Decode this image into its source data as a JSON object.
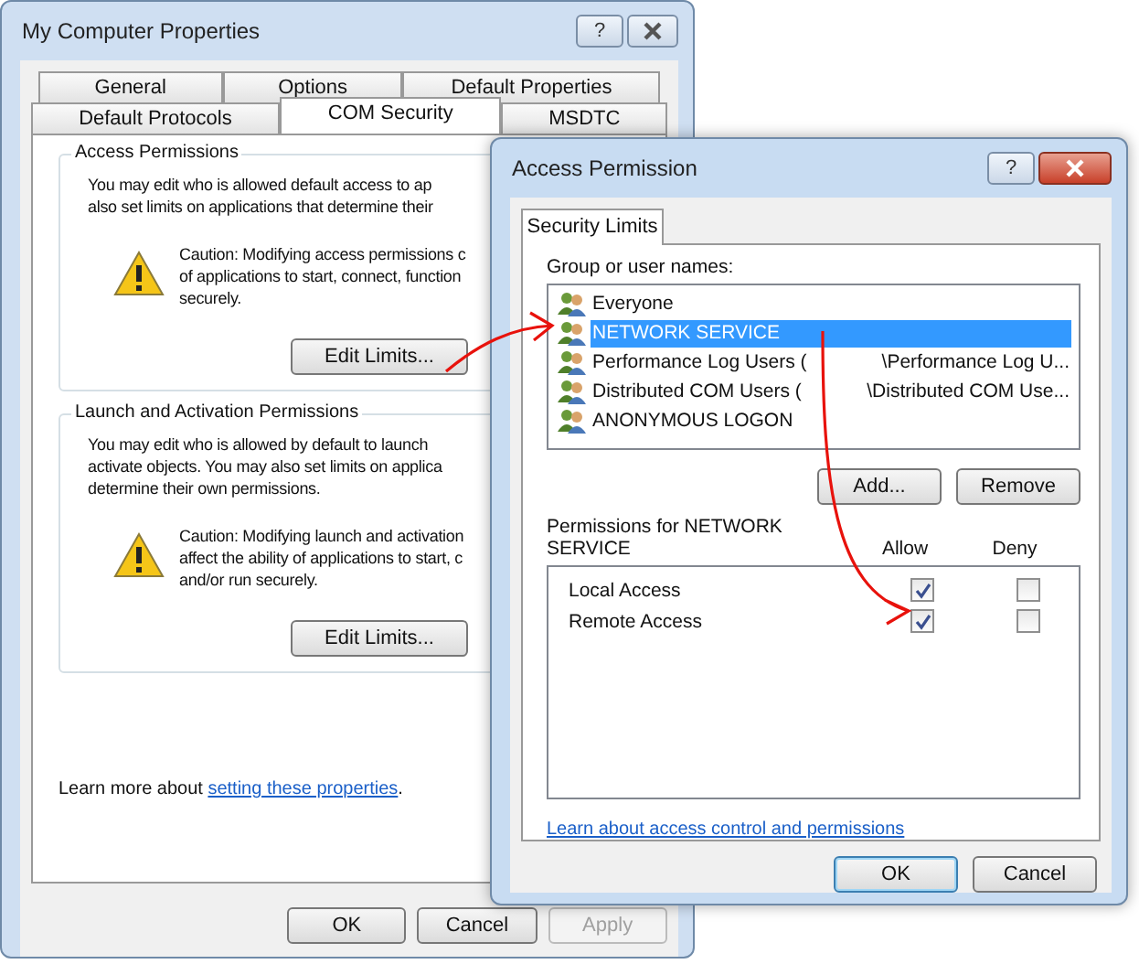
{
  "main_window": {
    "title": "My Computer Properties",
    "help_button": "?",
    "tab_rows": [
      [
        {
          "label": "General",
          "selected": false
        },
        {
          "label": "Options",
          "selected": false
        },
        {
          "label": "Default Properties",
          "selected": false
        }
      ],
      [
        {
          "label": "Default Protocols",
          "selected": false
        },
        {
          "label": "COM Security",
          "selected": true
        },
        {
          "label": "MSDTC",
          "selected": false
        }
      ]
    ],
    "groups": [
      {
        "title": "Access Permissions",
        "lines": [
          "You may edit who is allowed default access to ap",
          "also set limits on applications that determine their"
        ],
        "caution_lines": [
          "Caution: Modifying access permissions c",
          "of applications to start, connect, function",
          "securely."
        ],
        "button": "Edit Limits..."
      },
      {
        "title": "Launch and Activation Permissions",
        "lines": [
          "You may edit who is allowed by default to launch",
          "activate objects. You may also set limits on applica",
          "determine their own permissions."
        ],
        "caution_lines": [
          "Caution: Modifying launch and activation",
          "affect the ability of applications to start, c",
          "and/or run securely."
        ],
        "button": "Edit Limits..."
      }
    ],
    "learn_more": {
      "text": "Learn more about ",
      "link": "setting these properties",
      "suffix": "."
    },
    "buttons": [
      {
        "label": "OK",
        "disabled": false
      },
      {
        "label": "Cancel",
        "disabled": false
      },
      {
        "label": "Apply",
        "disabled": true
      }
    ]
  },
  "dialog": {
    "title": "Access Permission",
    "help_button": "?",
    "tab": {
      "label": "Security Limits",
      "selected": true
    },
    "users_label": "Group or user names:",
    "users": [
      {
        "name": "Everyone",
        "selected": false
      },
      {
        "name": "NETWORK SERVICE",
        "selected": true
      },
      {
        "name": "Performance Log Users (",
        "domain": "\\Performance Log U...",
        "selected": false
      },
      {
        "name": "Distributed COM Users (",
        "domain": "\\Distributed COM Use...",
        "selected": false
      },
      {
        "name": "ANONYMOUS LOGON",
        "selected": false
      }
    ],
    "add_button": "Add...",
    "remove_button": "Remove",
    "permissions_label": "Permissions for NETWORK SERVICE",
    "allow_heading": "Allow",
    "deny_heading": "Deny",
    "permissions": [
      {
        "name": "Local Access",
        "allow": true,
        "deny": false
      },
      {
        "name": "Remote Access",
        "allow": true,
        "deny": false
      }
    ],
    "link": "Learn about access control and permissions",
    "buttons": [
      "OK",
      "Cancel"
    ]
  }
}
